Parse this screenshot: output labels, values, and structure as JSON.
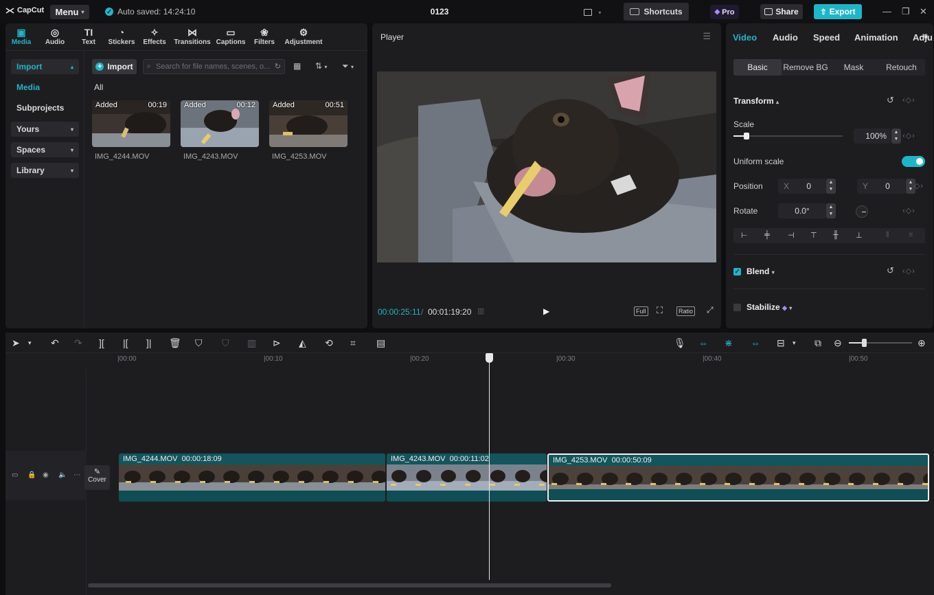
{
  "app": {
    "logo": "CapCut",
    "menu_label": "Menu",
    "autosave": "Auto saved: 14:24:10",
    "project_title": "0123",
    "shortcuts_label": "Shortcuts",
    "pro_label": "Pro",
    "share_label": "Share",
    "export_label": "Export"
  },
  "media_tabs": [
    {
      "label": "Media",
      "icon": "media-icon"
    },
    {
      "label": "Audio",
      "icon": "audio-icon"
    },
    {
      "label": "Text",
      "icon": "text-icon"
    },
    {
      "label": "Stickers",
      "icon": "stickers-icon"
    },
    {
      "label": "Effects",
      "icon": "effects-icon"
    },
    {
      "label": "Transitions",
      "icon": "transitions-icon"
    },
    {
      "label": "Captions",
      "icon": "captions-icon"
    },
    {
      "label": "Filters",
      "icon": "filters-icon"
    },
    {
      "label": "Adjustment",
      "icon": "adjustment-icon"
    }
  ],
  "media_side": [
    {
      "label": "Import"
    },
    {
      "label": "Media"
    },
    {
      "label": "Subprojects"
    },
    {
      "label": "Yours"
    },
    {
      "label": "Spaces"
    },
    {
      "label": "Library"
    }
  ],
  "media": {
    "import_label": "Import",
    "search_placeholder": "Search for file names, scenes, o...",
    "all_label": "All",
    "items": [
      {
        "name": "IMG_4244.MOV",
        "status": "Added",
        "duration": "00:19"
      },
      {
        "name": "IMG_4243.MOV",
        "status": "Added",
        "duration": "00:12"
      },
      {
        "name": "IMG_4253.MOV",
        "status": "Added",
        "duration": "00:51"
      }
    ]
  },
  "player": {
    "title": "Player",
    "current_time": "00:00:25:11",
    "separator": "/",
    "total_time": "00:01:19:20",
    "full_label": "Full",
    "ratio_label": "Ratio"
  },
  "inspector": {
    "tabs": [
      "Video",
      "Audio",
      "Speed",
      "Animation",
      "Adju"
    ],
    "subtabs": [
      "Basic",
      "Remove BG",
      "Mask",
      "Retouch"
    ],
    "transform_label": "Transform",
    "scale_label": "Scale",
    "scale_value": "100%",
    "scale_fraction": 0.12,
    "uniform_scale_label": "Uniform scale",
    "position_label": "Position",
    "pos_x_label": "X",
    "pos_x_value": "0",
    "pos_y_label": "Y",
    "pos_y_value": "0",
    "rotate_label": "Rotate",
    "rotate_value": "0.0°",
    "blend_label": "Blend",
    "stabilize_label": "Stabilize"
  },
  "timeline": {
    "ticks": [
      "|00:00",
      "|00:10",
      "|00:20",
      "|00:30",
      "|00:40",
      "|00:50"
    ],
    "cover_label": "Cover",
    "clips": [
      {
        "name": "IMG_4244.MOV",
        "duration": "00:00:18:09"
      },
      {
        "name": "IMG_4243.MOV",
        "duration": "00:00:11:02"
      },
      {
        "name": "IMG_4253.MOV",
        "duration": "00:00:50:09"
      }
    ]
  },
  "colors": {
    "accent": "#1fb5c9",
    "panel": "#1d1d20",
    "clip": "#12555d"
  }
}
